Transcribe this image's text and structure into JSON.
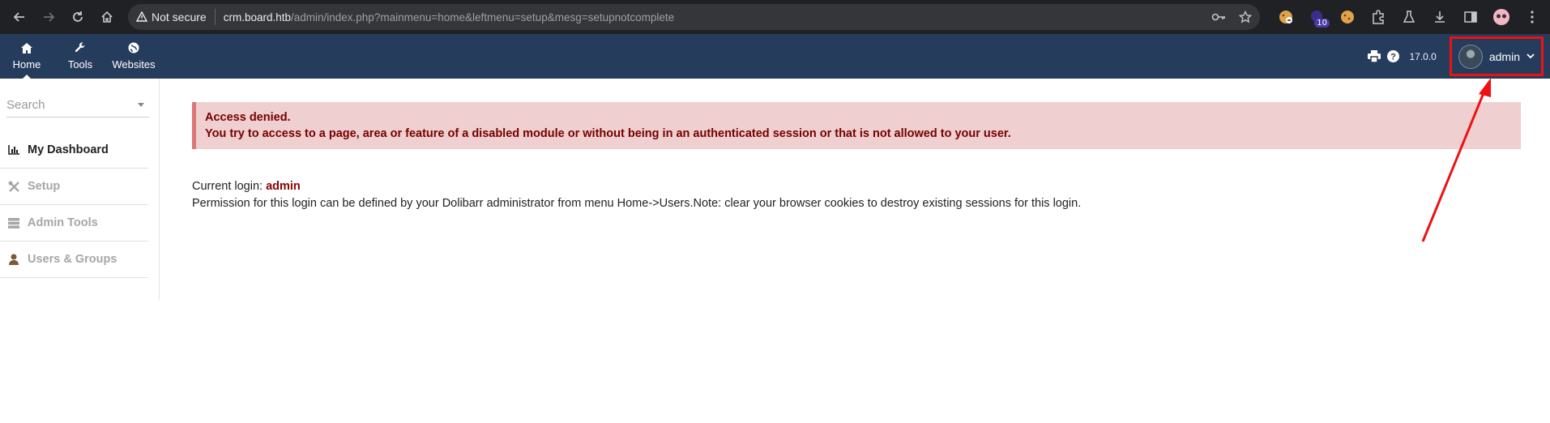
{
  "browser": {
    "security_label": "Not secure",
    "url_host": "crm.board.htb",
    "url_path": "/admin/index.php?mainmenu=home&leftmenu=setup&mesg=setupnotcomplete",
    "ext_badge": "10"
  },
  "topmenu": {
    "items": [
      {
        "label": "Home",
        "icon": "home-icon"
      },
      {
        "label": "Tools",
        "icon": "wrench-icon"
      },
      {
        "label": "Websites",
        "icon": "globe-icon"
      }
    ],
    "version": "17.0.0",
    "user_name": "admin"
  },
  "sidebar": {
    "search_placeholder": "Search",
    "items": [
      {
        "label": "My Dashboard",
        "icon": "chart-icon"
      },
      {
        "label": "Setup",
        "icon": "tools-icon"
      },
      {
        "label": "Admin Tools",
        "icon": "server-icon"
      },
      {
        "label": "Users & Groups",
        "icon": "user-icon"
      }
    ]
  },
  "error": {
    "title": "Access denied.",
    "message": "You try to access to a page, area or feature of a disabled module or without being in an authenticated session or that is not allowed to your user."
  },
  "login": {
    "label": "Current login: ",
    "name": "admin",
    "permission_text": "Permission for this login can be defined by your Dolibarr administrator from menu Home->Users.Note: clear your browser cookies to destroy existing sessions for this login."
  },
  "colors": {
    "topbar": "#263c5c",
    "error_bg": "#efcfcf",
    "error_text": "#770000",
    "highlight": "#ee1111"
  }
}
